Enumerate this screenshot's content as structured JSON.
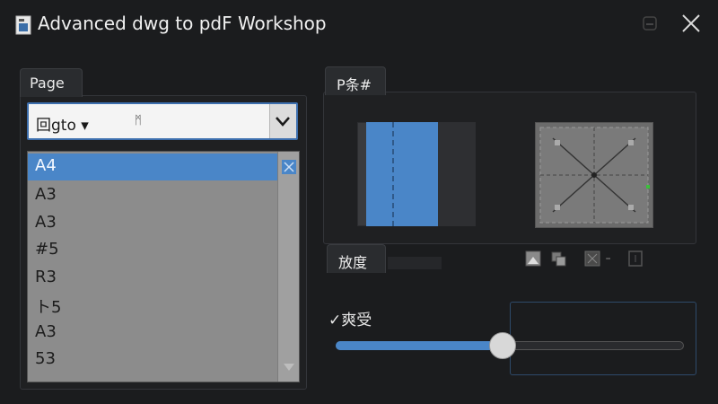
{
  "window": {
    "title": "Advanced dwg to pdF Workshop"
  },
  "page_panel": {
    "tab_label": "Page",
    "dropdown": {
      "selected": "回gto ▾",
      "extra": "ᛗ"
    },
    "size_list": [
      {
        "label": "A4",
        "selected": true
      },
      {
        "label": "A3",
        "selected": false
      },
      {
        "label": "A3",
        "selected": false
      },
      {
        "label": "#5",
        "selected": false
      },
      {
        "label": "R3",
        "selected": false
      },
      {
        "label": "ト5",
        "selected": false
      },
      {
        "label": "A3",
        "selected": false
      },
      {
        "label": "53",
        "selected": false
      }
    ]
  },
  "preview_panel": {
    "tab_label": "P条#"
  },
  "orientation_panel": {
    "tab_label": "放度"
  },
  "scale_panel": {
    "label": "✓爽受",
    "slider_value_fraction": 0.48
  },
  "icons": {
    "app": "document-icon",
    "minimize": "minimize-icon",
    "close": "close-icon",
    "dropdown_arrow": "chevron-down-icon"
  },
  "colors": {
    "accent": "#4a86c8",
    "background": "#1b1c1e"
  }
}
